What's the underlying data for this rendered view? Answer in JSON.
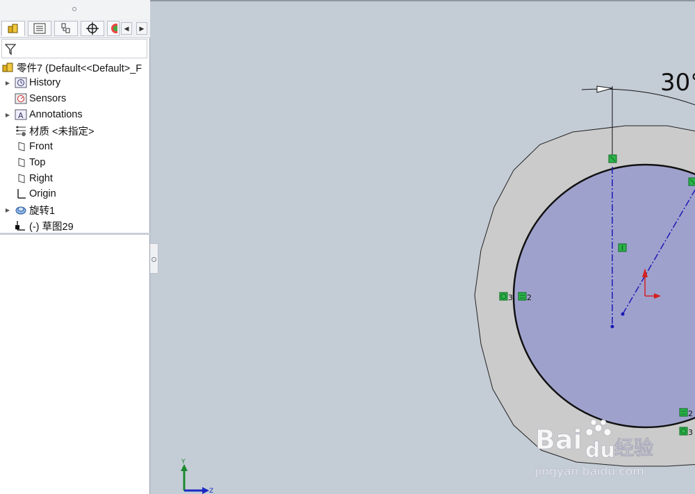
{
  "tree": {
    "root": "零件7  (Default<<Default>_F",
    "items": [
      {
        "label": "History",
        "expandable": true
      },
      {
        "label": "Sensors",
        "expandable": false
      },
      {
        "label": "Annotations",
        "expandable": true
      },
      {
        "label": "材质 <未指定>",
        "expandable": false
      },
      {
        "label": "Front",
        "expandable": false
      },
      {
        "label": "Top",
        "expandable": false
      },
      {
        "label": "Right",
        "expandable": false
      },
      {
        "label": "Origin",
        "expandable": false
      },
      {
        "label": "旋转1",
        "expandable": true
      },
      {
        "label": "(-) 草图29",
        "expandable": false
      }
    ]
  },
  "sketch": {
    "angle_dimension": "30°",
    "relation_labels": [
      "3",
      "2",
      "2",
      "3"
    ]
  },
  "triad": {
    "y": "Y",
    "z": "Z"
  },
  "watermark": {
    "line1": "Bai",
    "line2": "du",
    "line3": "经验",
    "line4": "jingyan.baidu.com"
  },
  "colors": {
    "background": "#c4ccd6",
    "face_fill": "#9fa1cd",
    "ring_fill": "#cbcbcb",
    "centerline": "#1a1ab5",
    "relation_green": "#2db34a",
    "origin_red": "#d42020"
  }
}
